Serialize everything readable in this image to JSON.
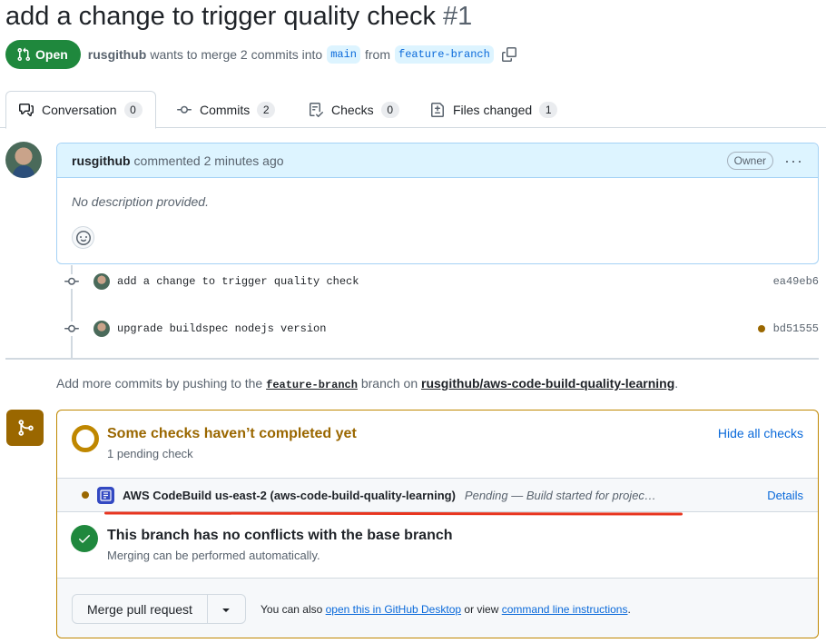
{
  "pr": {
    "title": "add a change to trigger quality check",
    "number": "#1",
    "state": "Open",
    "author": "rusgithub",
    "merge_text": "wants to merge 2 commits into",
    "base_branch": "main",
    "from_text": "from",
    "head_branch": "feature-branch"
  },
  "tabs": [
    {
      "label": "Conversation",
      "count": "0",
      "icon": "comment-discussion-icon"
    },
    {
      "label": "Commits",
      "count": "2",
      "icon": "git-commit-icon"
    },
    {
      "label": "Checks",
      "count": "0",
      "icon": "checklist-icon"
    },
    {
      "label": "Files changed",
      "count": "1",
      "icon": "file-diff-icon"
    }
  ],
  "comment": {
    "author": "rusgithub",
    "action": "commented 2 minutes ago",
    "role": "Owner",
    "body": "No description provided."
  },
  "commits": [
    {
      "message": "add a change to trigger quality check",
      "sha": "ea49eb6",
      "pending": false
    },
    {
      "message": "upgrade buildspec nodejs version",
      "sha": "bd51555",
      "pending": true
    }
  ],
  "push_hint": {
    "prefix": "Add more commits by pushing to the",
    "branch": "feature-branch",
    "middle": "branch on",
    "repo": "rusgithub/aws-code-build-quality-learning",
    "suffix": "."
  },
  "checks": {
    "title": "Some checks haven’t completed yet",
    "subtitle": "1 pending check",
    "toggle_label": "Hide all checks",
    "items": [
      {
        "name": "AWS CodeBuild us-east-2 (aws-code-build-quality-learning)",
        "status": "Pending — Build started for projec…",
        "details_label": "Details"
      }
    ]
  },
  "conflicts": {
    "title": "This branch has no conflicts with the base branch",
    "subtitle": "Merging can be performed automatically."
  },
  "merge": {
    "button_label": "Merge pull request",
    "also_text": "You can also",
    "desktop_link": "open this in GitHub Desktop",
    "or_view": "or view",
    "cli_link": "command line instructions",
    "end": "."
  },
  "colors": {
    "open_green": "#1f883d",
    "pending_amber": "#9a6700",
    "link_blue": "#0969da",
    "annotation_red": "#e8351f"
  }
}
